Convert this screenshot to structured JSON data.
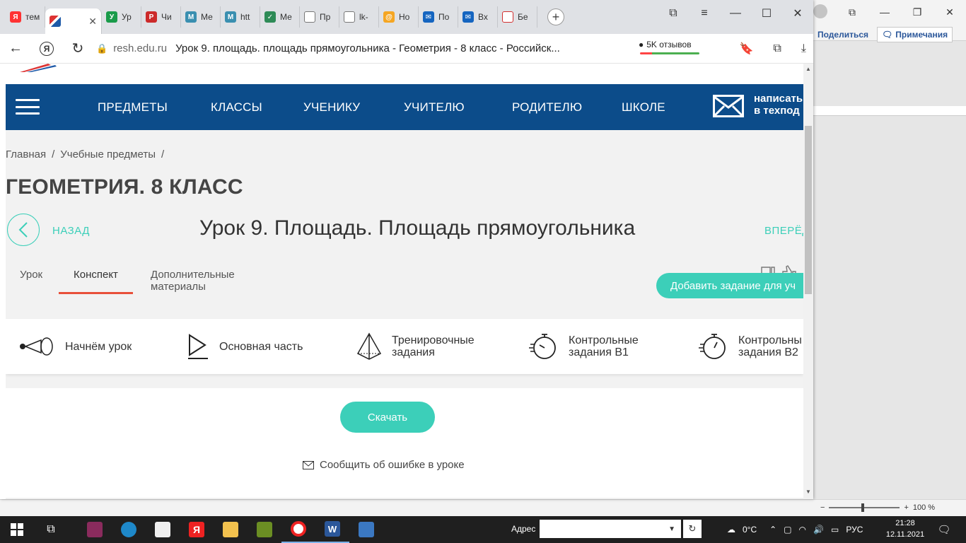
{
  "browser": {
    "tabs": [
      {
        "label": "тем",
        "favicon": "Я",
        "color": "#ff3333"
      },
      {
        "label": "",
        "favicon": "resh-icon",
        "color": "#ffffff",
        "active": true
      },
      {
        "label": "Ур",
        "favicon": "У",
        "color": "#1a9b4a"
      },
      {
        "label": "Чи",
        "favicon": "Р",
        "color": "#cc2a2a"
      },
      {
        "label": "Ме",
        "favicon": "M",
        "color": "#3a8fb0"
      },
      {
        "label": "htt",
        "favicon": "M",
        "color": "#3a8fb0"
      },
      {
        "label": "Ме",
        "favicon": "✓",
        "color": "#2e8b57"
      },
      {
        "label": "Пр",
        "favicon": "doc",
        "color": "#777777"
      },
      {
        "label": "lk-",
        "favicon": "doc",
        "color": "#777777"
      },
      {
        "label": "Но",
        "favicon": "@",
        "color": "#f5a623"
      },
      {
        "label": "По",
        "favicon": "✉",
        "color": "#1565c0"
      },
      {
        "label": "Вх",
        "favicon": "✉",
        "color": "#1565c0"
      },
      {
        "label": "Бе",
        "favicon": "pdf",
        "color": "#d32f2f"
      }
    ],
    "url_domain": "resh.edu.ru",
    "page_title": "Урок 9. площадь. площадь прямоугольника - Геометрия - 8 класс - Российск...",
    "reviews": "5K отзывов"
  },
  "site": {
    "nav": [
      "ПРЕДМЕТЫ",
      "КЛАССЫ",
      "УЧЕНИКУ",
      "УЧИТЕЛЮ",
      "РОДИТЕЛЮ",
      "ШКОЛЕ"
    ],
    "support_line1": "написать",
    "support_line2": "в техпод",
    "breadcrumb": [
      "Главная",
      "/",
      "Учебные предметы",
      "/"
    ],
    "subject_title": "ГЕОМЕТРИЯ. 8 КЛАСС",
    "back_label": "НАЗАД",
    "lesson_title": "Урок 9. Площадь. Площадь прямоугольника",
    "next_label": "ВПЕРЁД",
    "subtabs": [
      "Урок",
      "Конспект",
      "Дополнительные материалы"
    ],
    "add_task_label": "Добавить задание для уч",
    "steps": [
      {
        "l1": "Начнём урок",
        "l2": ""
      },
      {
        "l1": "Основная часть",
        "l2": ""
      },
      {
        "l1": "Тренировочные",
        "l2": "задания"
      },
      {
        "l1": "Контрольные",
        "l2": "задания В1"
      },
      {
        "l1": "Контрольны",
        "l2": "задания В2"
      }
    ],
    "download_label": "Скачать",
    "report_label": "Сообщить об ошибке в уроке"
  },
  "word": {
    "share_label": "Поделиться",
    "notes_label": "Примечания",
    "zoom": "100 %"
  },
  "taskbar": {
    "address_label": "Адрес",
    "weather": "0°C",
    "lang": "РУС",
    "time": "21:28",
    "date": "12.11.2021"
  },
  "colors": {
    "nav_blue": "#0c4c8a",
    "accent_teal": "#3ccfb9",
    "active_tab_underline": "#e8503a"
  }
}
